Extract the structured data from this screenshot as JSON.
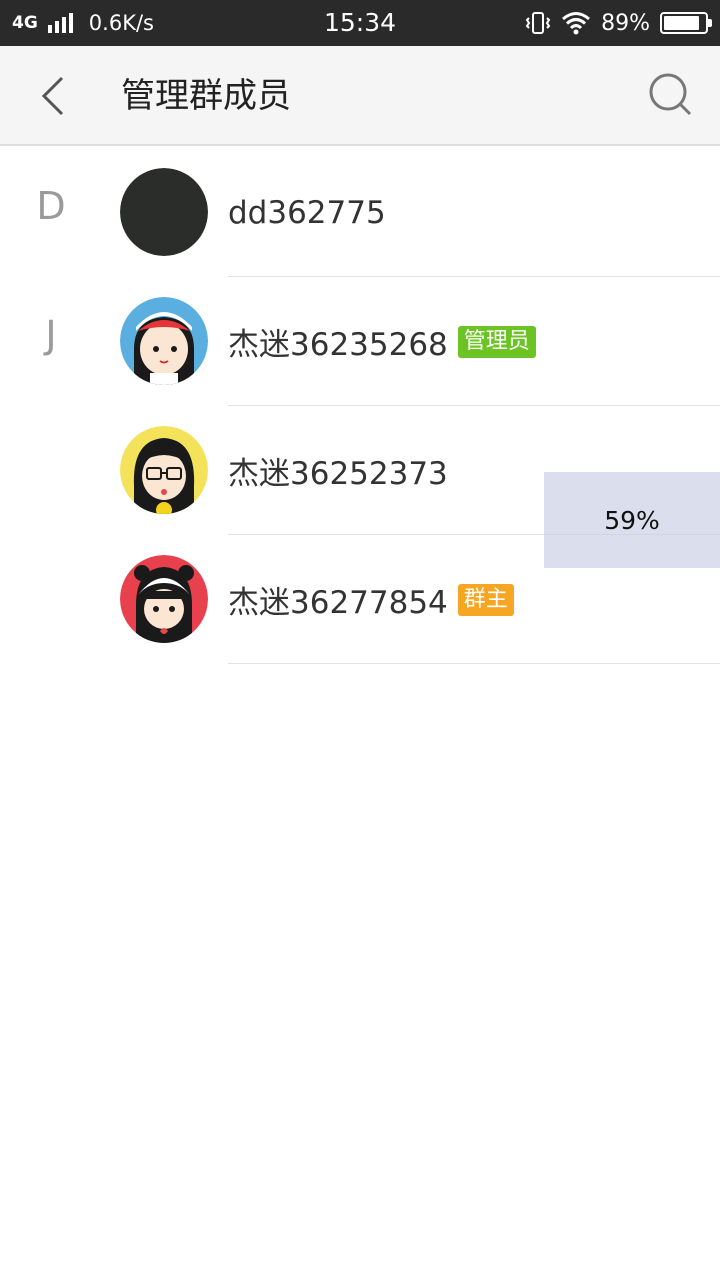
{
  "status_bar": {
    "network": "4G",
    "speed": "0.6K/s",
    "time": "15:34",
    "battery_percent": "89%",
    "battery_level": 0.89,
    "icons": [
      "signal-icon",
      "vibrate-icon",
      "wifi-icon",
      "battery-icon"
    ]
  },
  "toolbar": {
    "title": "管理群成员",
    "back_icon": "chevron-left-icon",
    "search_icon": "search-icon"
  },
  "members": [
    {
      "section": "D",
      "name": "dd362775",
      "badge": "",
      "avatar_color": "#2b2d2a"
    },
    {
      "section": "J",
      "name": "杰迷36235268",
      "badge": "管理员",
      "avatar_color": "#5aaee0"
    },
    {
      "section": "",
      "name": "杰迷36252373",
      "badge": "",
      "avatar_color": "#f3e25a"
    },
    {
      "section": "",
      "name": "杰迷36277854",
      "badge": "群主",
      "avatar_color": "#e8404c"
    }
  ],
  "overlay": {
    "progress_text": "59%"
  },
  "colors": {
    "admin_badge": "#6cc424",
    "owner_badge": "#f6a623"
  }
}
